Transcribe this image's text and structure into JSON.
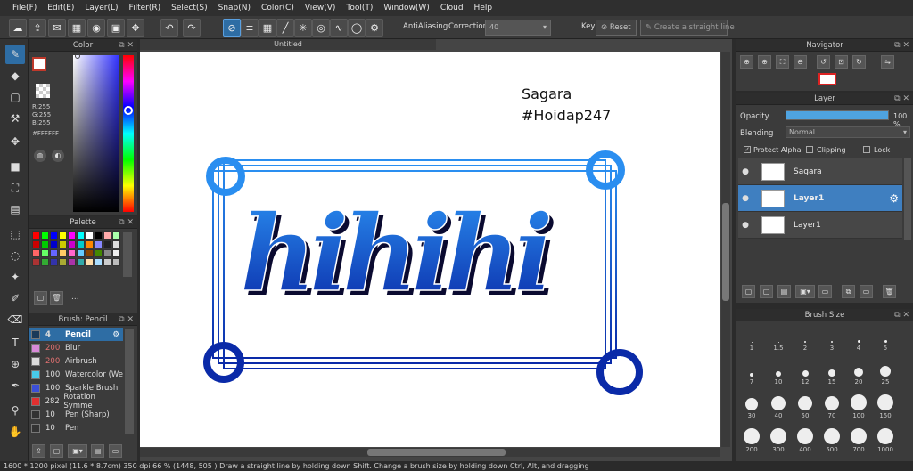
{
  "menu": [
    "File(F)",
    "Edit(E)",
    "Layer(L)",
    "Filter(R)",
    "Select(S)",
    "Snap(N)",
    "Color(C)",
    "View(V)",
    "Tool(T)",
    "Window(W)",
    "Cloud",
    "Help"
  ],
  "toolbar": {
    "antialiasing_label": "AntiAliasing",
    "correction_label": "Correction",
    "correction_value": "40",
    "key_label": "Key",
    "reset_label": "Reset",
    "straight_line_label": "Create a straight line"
  },
  "color_panel": {
    "title": "Color",
    "r": "R:255",
    "g": "G:255",
    "b": "B:255",
    "hex": "#FFFFFF"
  },
  "palette_panel": {
    "title": "Palette",
    "dots": "..."
  },
  "brush_panel": {
    "title": "Brush: Pencil",
    "items": [
      {
        "size": "4",
        "name": "Pencil",
        "color": "#1a3a5a"
      },
      {
        "size": "200",
        "name": "Blur",
        "color": "#d98ad9"
      },
      {
        "size": "200",
        "name": "Airbrush",
        "color": "#dddddd"
      },
      {
        "size": "100",
        "name": "Watercolor (We",
        "color": "#48c9e8"
      },
      {
        "size": "100",
        "name": "Sparkle Brush",
        "color": "#3b4fd8"
      },
      {
        "size": "282",
        "name": "Rotation Symme",
        "color": "#e03030"
      },
      {
        "size": "10",
        "name": "Pen (Sharp)",
        "color": "#333333"
      },
      {
        "size": "10",
        "name": "Pen",
        "color": "#333333"
      }
    ]
  },
  "canvas": {
    "tab_title": "Untitled",
    "text_line1": "Sagara",
    "text_line2": "#Hoidap247",
    "art_text": "hihihi"
  },
  "navigator": {
    "title": "Navigator"
  },
  "layer_panel": {
    "title": "Layer",
    "opacity_label": "Opacity",
    "opacity_value": "100 %",
    "opacity_fraction": 1.0,
    "blending_label": "Blending",
    "blending_value": "Normal",
    "protect_alpha": "Protect Alpha",
    "clipping": "Clipping",
    "lock": "Lock",
    "layers": [
      {
        "name": "Sagara",
        "selected": false
      },
      {
        "name": "Layer1",
        "selected": true
      },
      {
        "name": "Layer1",
        "selected": false
      }
    ]
  },
  "brush_size_panel": {
    "title": "Brush Size",
    "sizes": [
      "1",
      "1.5",
      "2",
      "3",
      "4",
      "5",
      "7",
      "10",
      "12",
      "15",
      "20",
      "25",
      "30",
      "40",
      "50",
      "70",
      "100",
      "150",
      "200",
      "300",
      "400",
      "500",
      "700",
      "1000"
    ]
  },
  "status": "1600 * 1200 pixel   (11.6 * 8.7cm)   350 dpi   66 %   (1448, 505 )   Draw a straight line by holding down Shift. Change a brush size by holding down Ctrl, Alt, and dragging"
}
